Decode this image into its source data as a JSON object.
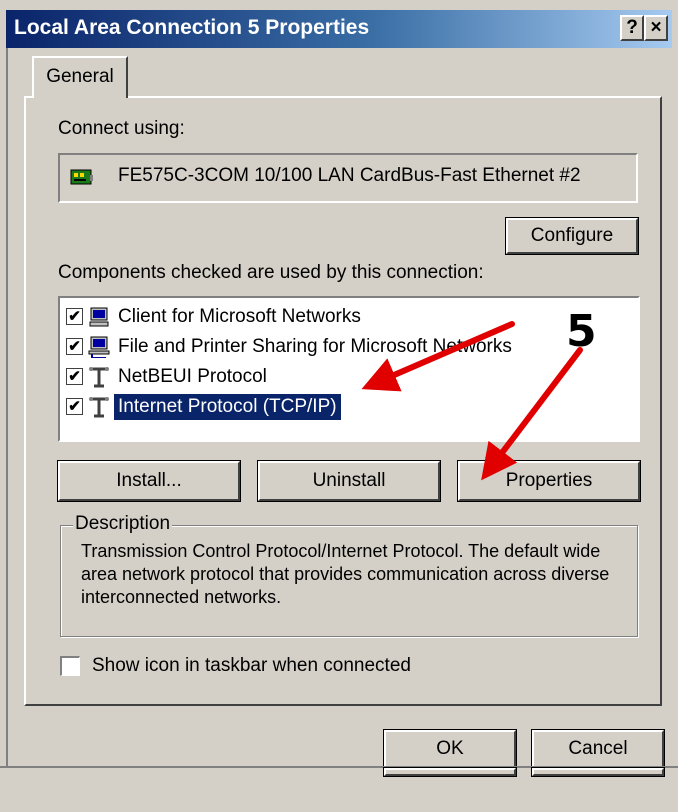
{
  "window": {
    "title": "Local Area Connection 5 Properties",
    "help_label": "?",
    "close_label": "×"
  },
  "tabs": [
    {
      "label": "General",
      "selected": true
    }
  ],
  "connect_using": {
    "label": "Connect using:",
    "adapter": "FE575C-3COM 10/100 LAN CardBus-Fast Ethernet #2",
    "configure_button": "Configure"
  },
  "components": {
    "label": "Components checked are used by this connection:",
    "items": [
      {
        "label": "Client for Microsoft Networks",
        "checked": true,
        "icon": "network-client-icon",
        "selected": false
      },
      {
        "label": "File and Printer Sharing for Microsoft Networks",
        "checked": true,
        "icon": "network-service-icon",
        "selected": false
      },
      {
        "label": "NetBEUI Protocol",
        "checked": true,
        "icon": "protocol-icon",
        "selected": false
      },
      {
        "label": "Internet Protocol (TCP/IP)",
        "checked": true,
        "icon": "protocol-icon",
        "selected": true
      }
    ],
    "check_mark": "✔"
  },
  "buttons": {
    "install": "Install...",
    "uninstall": "Uninstall",
    "properties": "Properties"
  },
  "description": {
    "title": "Description",
    "text": "Transmission Control Protocol/Internet Protocol. The default wide area network protocol that provides communication across diverse interconnected networks."
  },
  "show_icon": {
    "label": "Show icon in taskbar when connected",
    "checked": false
  },
  "dialog_buttons": {
    "ok": "OK",
    "cancel": "Cancel"
  },
  "annotation": {
    "step_number": "5",
    "arrow_color": "#e00000"
  },
  "colors": {
    "title_bar_start": "#0a246a",
    "title_bar_end": "#a6caf0",
    "selection": "#0a246a",
    "face": "#d4d0c8"
  }
}
